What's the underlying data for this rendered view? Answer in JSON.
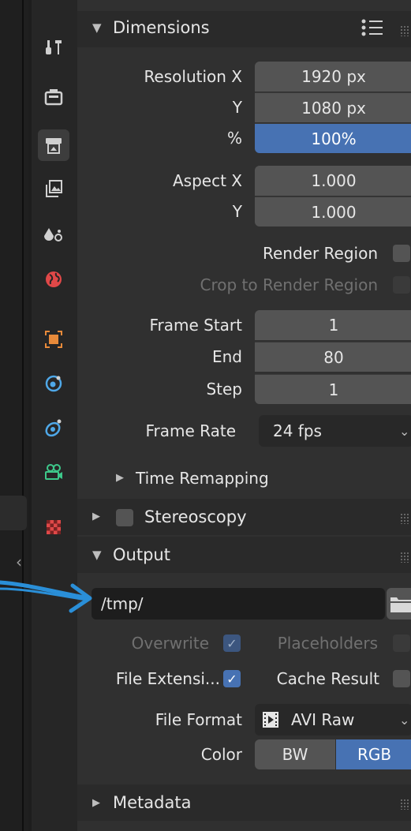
{
  "tabs": [
    {
      "icon": "tool-icon",
      "color": "#d0d0d0"
    },
    {
      "icon": "render-icon",
      "color": "#d0d0d0"
    },
    {
      "icon": "output-icon",
      "color": "#d0d0d0",
      "active": true
    },
    {
      "icon": "view-layer-icon",
      "color": "#d0d0d0"
    },
    {
      "icon": "scene-icon",
      "color": "#d0d0d0"
    },
    {
      "icon": "world-icon",
      "color": "#e04848"
    },
    {
      "icon": "object-icon",
      "color": "#e88a3a"
    },
    {
      "icon": "physics-icon",
      "color": "#4fa8e8"
    },
    {
      "icon": "constraints-icon",
      "color": "#4fa8e8"
    },
    {
      "icon": "object-data-camera-icon",
      "color": "#3dc88a"
    },
    {
      "icon": "texture-icon",
      "color": "#e04848"
    }
  ],
  "dimensions": {
    "title": "Dimensions",
    "resolution_x_label": "Resolution X",
    "resolution_x": "1920 px",
    "resolution_y_label": "Y",
    "resolution_y": "1080 px",
    "percent_label": "%",
    "percent": "100%",
    "aspect_x_label": "Aspect X",
    "aspect_x": "1.000",
    "aspect_y_label": "Y",
    "aspect_y": "1.000",
    "render_region_label": "Render Region",
    "crop_label": "Crop to Render Region",
    "frame_start_label": "Frame Start",
    "frame_start": "1",
    "end_label": "End",
    "end": "80",
    "step_label": "Step",
    "step": "1",
    "frame_rate_label": "Frame Rate",
    "frame_rate": "24 fps",
    "time_remapping": "Time Remapping"
  },
  "stereoscopy": {
    "title": "Stereoscopy"
  },
  "output": {
    "title": "Output",
    "path": "/tmp/",
    "overwrite_label": "Overwrite",
    "placeholders_label": "Placeholders",
    "file_ext_label": "File Extensi...",
    "cache_result_label": "Cache Result",
    "file_format_label": "File Format",
    "file_format": "AVI Raw",
    "color_label": "Color",
    "color_bw": "BW",
    "color_rgb": "RGB"
  },
  "metadata": {
    "title": "Metadata"
  },
  "accent": "#4772b3",
  "annotation_color": "#2a8fd8"
}
